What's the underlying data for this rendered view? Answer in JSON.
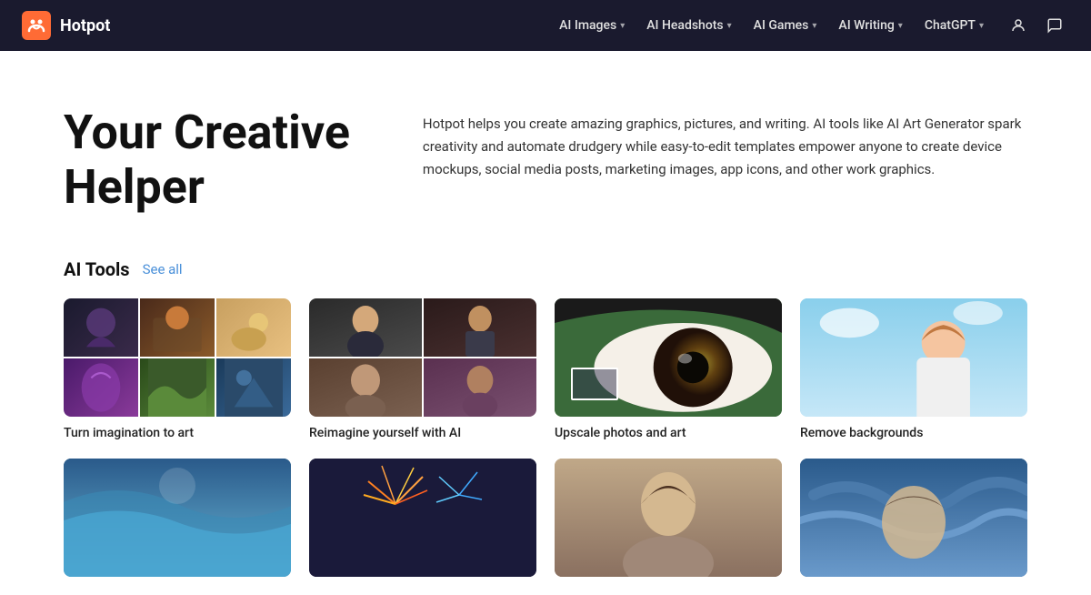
{
  "nav": {
    "brand": "Hotpot",
    "links": [
      {
        "id": "ai-images",
        "label": "AI Images",
        "hasDropdown": true
      },
      {
        "id": "ai-headshots",
        "label": "AI Headshots",
        "hasDropdown": true
      },
      {
        "id": "ai-games",
        "label": "AI Games",
        "hasDropdown": true
      },
      {
        "id": "ai-writing",
        "label": "AI Writing",
        "hasDropdown": true
      },
      {
        "id": "chatgpt",
        "label": "ChatGPT",
        "hasDropdown": true
      }
    ]
  },
  "hero": {
    "title_line1": "Your Creative",
    "title_line2": "Helper",
    "description": "Hotpot helps you create amazing graphics, pictures, and writing. AI tools like AI Art Generator spark creativity and automate drudgery while easy-to-edit templates empower anyone to create device mockups, social media posts, marketing images, app icons, and other work graphics."
  },
  "tools_section": {
    "title": "AI Tools",
    "see_all_label": "See all",
    "tools": [
      {
        "id": "imagine",
        "label": "Turn imagination to art"
      },
      {
        "id": "reimagine",
        "label": "Reimagine yourself with AI"
      },
      {
        "id": "upscale",
        "label": "Upscale photos and art"
      },
      {
        "id": "removebg",
        "label": "Remove backgrounds"
      }
    ],
    "tools_row2": [
      {
        "id": "ocean",
        "label": ""
      },
      {
        "id": "fireworks",
        "label": ""
      },
      {
        "id": "portrait",
        "label": ""
      },
      {
        "id": "painting",
        "label": ""
      }
    ]
  }
}
